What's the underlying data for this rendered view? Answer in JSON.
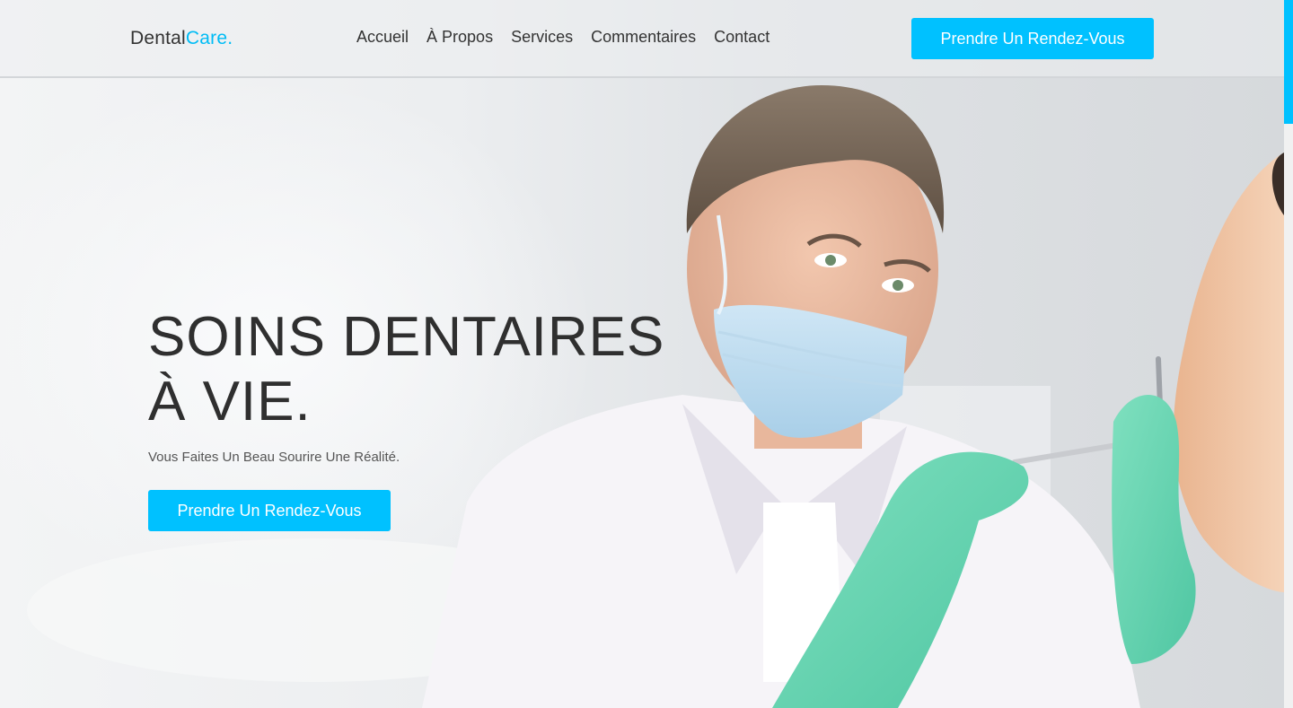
{
  "brand": {
    "name_part1": "Dental",
    "name_part2": "Care."
  },
  "nav": {
    "items": [
      "Accueil",
      "À Propos",
      "Services",
      "Commentaires",
      "Contact"
    ]
  },
  "header": {
    "cta_label": "Prendre Un Rendez-Vous"
  },
  "hero": {
    "title_line1": "SOINS DENTAIRES",
    "title_line2": "À VIE.",
    "subtitle": "Vous Faites Un Beau Sourire Une Réalité.",
    "cta_label": "Prendre Un Rendez-Vous",
    "image_subject": "dentist-with-mask-and-gloves-treating-patient"
  },
  "colors": {
    "accent": "#00c1ff",
    "text": "#333333"
  },
  "scrollbar": {
    "position_fraction": 0.0
  }
}
